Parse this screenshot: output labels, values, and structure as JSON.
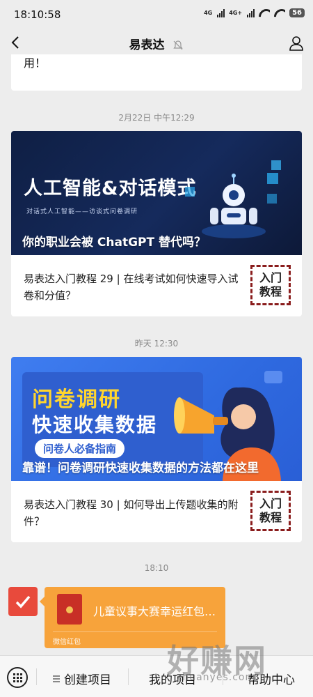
{
  "status": {
    "time": "18:10:58",
    "network1": "4G",
    "network2": "4G+",
    "battery": "56"
  },
  "nav": {
    "title": "易表达"
  },
  "feed": {
    "prev_message": "用！",
    "items": [
      {
        "timestamp": "2月22日 中午12:29",
        "banner_headline": "人工智能&对话模式",
        "banner_subline": "对话式人工智能——访谈式问卷调研",
        "banner_caption": "你的职业会被 ChatGPT 替代吗？",
        "title": "易表达入门教程 29 | 在线考试如何快速导入试卷和分值？",
        "badge_line1": "入门",
        "badge_line2": "教程"
      },
      {
        "timestamp": "昨天 12:30",
        "banner_line1": "问卷调研",
        "banner_line2": "快速收集数据",
        "banner_pill": "问卷人必备指南",
        "banner_caption": "靠谱！问卷调研快速收集数据的方法都在这里",
        "title": "易表达入门教程 30 | 如何导出上传题收集的附件？",
        "badge_line1": "入门",
        "badge_line2": "教程"
      }
    ],
    "chat_timestamp": "18:10",
    "red_packet": {
      "title": "儿童议事大赛幸运红包…",
      "label": "微信红包"
    }
  },
  "bottom_menu": {
    "items": [
      {
        "label": "创建项目"
      },
      {
        "label": "我的项目"
      },
      {
        "label": "帮助中心"
      }
    ]
  },
  "watermark": {
    "big": "好赚网",
    "small": "zhuanyes.com"
  }
}
